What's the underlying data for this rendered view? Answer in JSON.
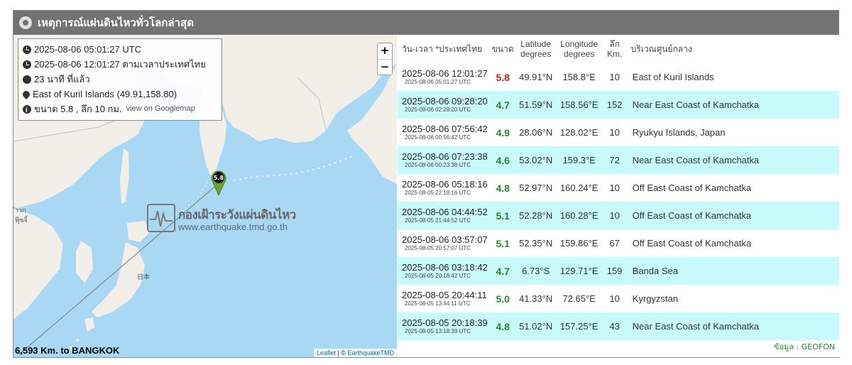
{
  "header": {
    "title": "เหตุการณ์แผ่นดินไหวทั่วโลกล่าสุด"
  },
  "map": {
    "zoom_in_label": "+",
    "zoom_out_label": "−",
    "info": {
      "utc_time": "2025-08-06 05:01:27 UTC",
      "thai_time": "2025-08-06 12:01:27 ตามเวลาประเทศไทย",
      "ago": "23 นาที ที่แล้ว",
      "location": "East of Kuril Islands (49.91,158.80)",
      "detail": "ขนาด 5.8 , ลึก 10 กม.",
      "gmap_link": "view on Googlemap"
    },
    "marker_label": "5.8",
    "watermark_title": "กองเฝ้าระวังแผ่นดินไหว",
    "watermark_url": "www.earthquake.tmd.go.th",
    "japan_label": "日本",
    "edge_label_1": "ำวก",
    "edge_label_2": "ฟุ๊ซจิ้",
    "distance_text": "6,593 Km. to BANGKOK",
    "attribution_leaflet": "Leaflet",
    "attribution_sep": " | © ",
    "attribution_owner": "EarthquakeTMD",
    "colors": {
      "sea": "#a9d8f5",
      "land": "#f2efe9",
      "marker": "#6aa532"
    }
  },
  "table": {
    "headers": {
      "datetime": "วัน-เวลา *ประเทศไทย",
      "magnitude": "ขนาด",
      "lat_1": "Latitude",
      "lat_2": "degrees",
      "lon_1": "Longitude",
      "lon_2": "degrees",
      "depth_1": "ลึก",
      "depth_2": "Km.",
      "region": "บริเวณศูนย์กลาง"
    },
    "rows": [
      {
        "thai": "2025-08-06 12:01:27",
        "utc": "2025-08-06 05:01:27 UTC",
        "mag": "5.8",
        "mag_color": "#d11a1a",
        "lat": "49.91°N",
        "lon": "158.8°E",
        "depth": "10",
        "region": "East of Kuril Islands"
      },
      {
        "thai": "2025-08-06 09:28:20",
        "utc": "2025-08-06 02:28:20 UTC",
        "mag": "4.7",
        "mag_color": "#2a8a2a",
        "lat": "51.59°N",
        "lon": "158.56°E",
        "depth": "152",
        "region": "Near East Coast of Kamchatka"
      },
      {
        "thai": "2025-08-06 07:56:42",
        "utc": "2025-08-06 00:56:42 UTC",
        "mag": "4.9",
        "mag_color": "#2a8a2a",
        "lat": "28.06°N",
        "lon": "128.02°E",
        "depth": "10",
        "region": "Ryukyu Islands, Japan"
      },
      {
        "thai": "2025-08-06 07:23:38",
        "utc": "2025-08-06 00:23:38 UTC",
        "mag": "4.6",
        "mag_color": "#2a8a2a",
        "lat": "53.02°N",
        "lon": "159.3°E",
        "depth": "72",
        "region": "Near East Coast of Kamchatka"
      },
      {
        "thai": "2025-08-06 05:18:16",
        "utc": "2025-08-05 22:18:16 UTC",
        "mag": "4.8",
        "mag_color": "#2a8a2a",
        "lat": "52.97°N",
        "lon": "160.24°E",
        "depth": "10",
        "region": "Off East Coast of Kamchatka"
      },
      {
        "thai": "2025-08-06 04:44:52",
        "utc": "2025-08-05 21:44:52 UTC",
        "mag": "5.1",
        "mag_color": "#2a8a2a",
        "lat": "52.28°N",
        "lon": "160.28°E",
        "depth": "10",
        "region": "Off East Coast of Kamchatka"
      },
      {
        "thai": "2025-08-06 03:57:07",
        "utc": "2025-08-05 20:57:07 UTC",
        "mag": "5.1",
        "mag_color": "#2a8a2a",
        "lat": "52.35°N",
        "lon": "159.86°E",
        "depth": "67",
        "region": "Off East Coast of Kamchatka"
      },
      {
        "thai": "2025-08-06 03:18:42",
        "utc": "2025-08-05 20:18:42 UTC",
        "mag": "4.7",
        "mag_color": "#2a8a2a",
        "lat": "6.73°S",
        "lon": "129.71°E",
        "depth": "159",
        "region": "Banda Sea"
      },
      {
        "thai": "2025-08-05 20:44:11",
        "utc": "2025-08-05 13:44:11 UTC",
        "mag": "5.0",
        "mag_color": "#2a8a2a",
        "lat": "41.33°N",
        "lon": "72.65°E",
        "depth": "10",
        "region": "Kyrgyzstan"
      },
      {
        "thai": "2025-08-05 20:18:39",
        "utc": "2025-08-05 13:18:39 UTC",
        "mag": "4.8",
        "mag_color": "#2a8a2a",
        "lat": "51.02°N",
        "lon": "157.25°E",
        "depth": "43",
        "region": "Near East Coast of Kamchatka"
      }
    ],
    "source": "ข้อมูล : GEOFON"
  }
}
